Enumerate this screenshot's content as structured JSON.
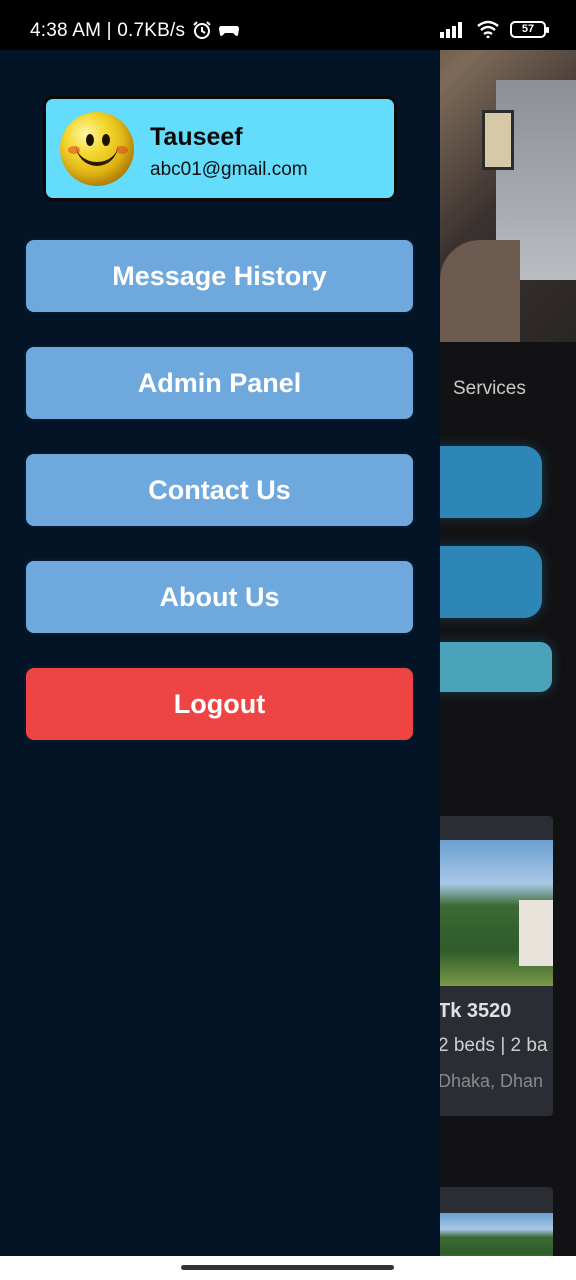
{
  "status_bar": {
    "time": "4:38 AM | 0.7KB/s",
    "battery": "57",
    "icons": [
      "alarm-icon",
      "game-controller-icon",
      "signal-icon",
      "wifi-icon",
      "battery-icon"
    ]
  },
  "background": {
    "services_label": "Services",
    "listing": {
      "price": "Tk 3520",
      "beds": "2 beds | 2 ba",
      "location": "Dhaka, Dhan"
    }
  },
  "drawer": {
    "profile": {
      "name": "Tauseef",
      "email": "abc01@gmail.com"
    },
    "menu": {
      "message_history": "Message History",
      "admin_panel": "Admin Panel",
      "contact_us": "Contact Us",
      "about_us": "About Us",
      "logout": "Logout"
    },
    "colors": {
      "drawer_bg": "#031426",
      "profile_card": "#64dcfc",
      "menu_button": "#6fa8dc",
      "logout_button": "#ef4444"
    }
  }
}
